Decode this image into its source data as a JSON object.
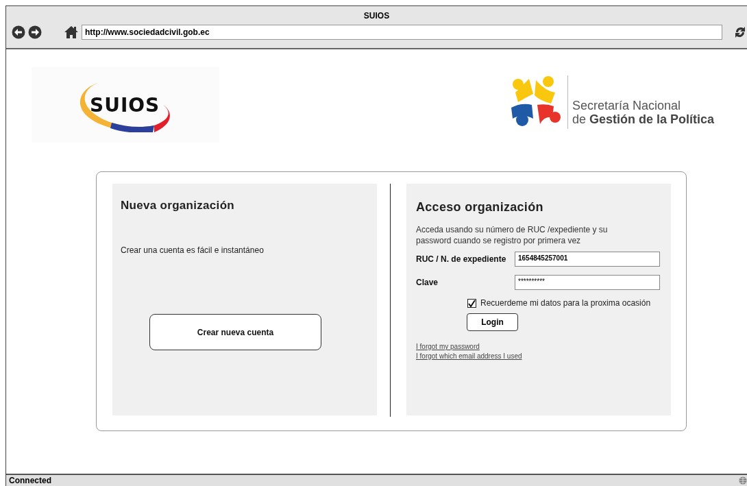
{
  "window": {
    "title": "SUIOS"
  },
  "toolbar": {
    "url": "http://www.sociedadcivil.gob.ec"
  },
  "header": {
    "logo_text": "SUIOS",
    "partner_line1": "Secretaría Nacional",
    "partner_line2_prefix": "de",
    "partner_line2_bold": "Gestión de la Política"
  },
  "new_org": {
    "title": "Nueva organización",
    "text": "Crear una cuenta es fácil e instantáneo",
    "button": "Crear nueva cuenta"
  },
  "login": {
    "title": "Acceso organización",
    "text": "Acceda usando su número de RUC /expediente y su password cuando se registro por primera vez",
    "fields": [
      {
        "label": "RUC / N. de expediente",
        "value": "1654845257001",
        "bold": true
      },
      {
        "label": "Clave",
        "value": "**********",
        "bold": false
      }
    ],
    "remember": {
      "label": "Recuerdeme mi datos para la proxima ocasión",
      "checked": true
    },
    "button": "Login",
    "links": [
      "I forgot my password",
      "I forgot which email address I used"
    ]
  },
  "status_bar": {
    "text": "Connected"
  }
}
